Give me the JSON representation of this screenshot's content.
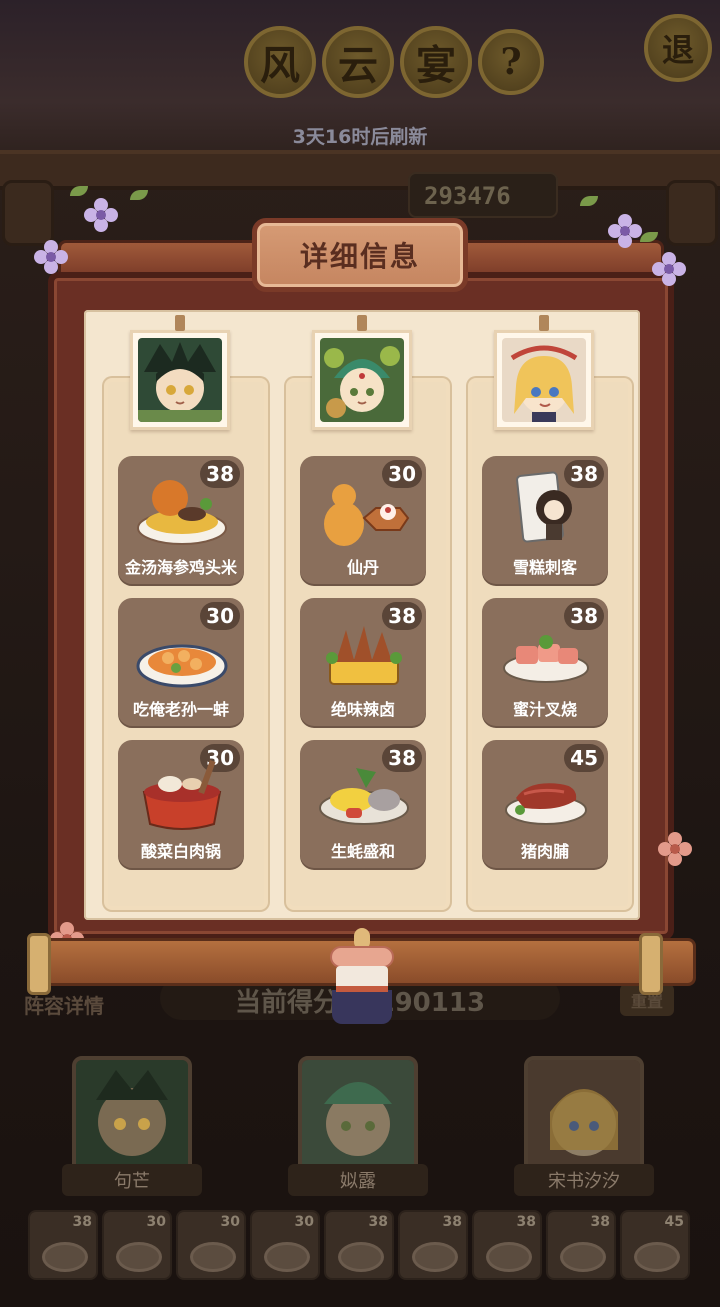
{
  "header": {
    "title_chars": [
      "风",
      "云",
      "宴"
    ],
    "help_glyph": "?",
    "exit_label": "退",
    "refresh_text": "3天16时后刷新",
    "top_score": "293476"
  },
  "bottom": {
    "lineup_label": "阵容详情",
    "score_text": "当前得分: 1190113",
    "reset_label": "重置",
    "characters": [
      {
        "name": "句芒"
      },
      {
        "name": "姒露"
      },
      {
        "name": "宋书汐汐"
      }
    ],
    "mini_dishes": [
      {
        "level": "38"
      },
      {
        "level": "30"
      },
      {
        "level": "30"
      },
      {
        "level": "30"
      },
      {
        "level": "38"
      },
      {
        "level": "38"
      },
      {
        "level": "38"
      },
      {
        "level": "38"
      },
      {
        "level": "45"
      }
    ]
  },
  "modal": {
    "title": "详细信息",
    "columns": [
      {
        "character": "句芒",
        "dishes": [
          {
            "name": "金汤海参鸡头米",
            "level": "38"
          },
          {
            "name": "吃俺老孙一蚌",
            "level": "30"
          },
          {
            "name": "酸菜白肉锅",
            "level": "30"
          }
        ]
      },
      {
        "character": "姒露",
        "dishes": [
          {
            "name": "仙丹",
            "level": "30"
          },
          {
            "name": "绝味辣卤",
            "level": "38"
          },
          {
            "name": "生蚝盛和",
            "level": "38"
          }
        ]
      },
      {
        "character": "宋书汐汐",
        "dishes": [
          {
            "name": "雪糕刺客",
            "level": "38"
          },
          {
            "name": "蜜汁叉烧",
            "level": "38"
          },
          {
            "name": "猪肉脯",
            "level": "45"
          }
        ]
      }
    ]
  },
  "colors": {
    "frame": "#6a2f24",
    "paper": "#f4e6cf",
    "dish_card": "#8a6f5c",
    "badge": "#5a4538",
    "title_tab": "#d69b75"
  }
}
